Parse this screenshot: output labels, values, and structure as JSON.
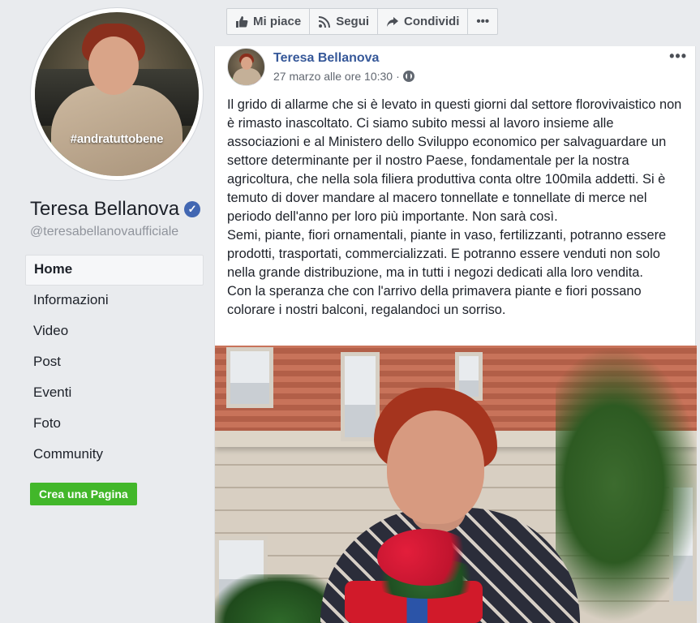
{
  "sidebar": {
    "profile_tag": "#andratuttobene",
    "page_name": "Teresa Bellanova",
    "handle": "@teresabellanovaufficiale",
    "nav_items": [
      {
        "label": "Home",
        "active": true
      },
      {
        "label": "Informazioni"
      },
      {
        "label": "Video"
      },
      {
        "label": "Post"
      },
      {
        "label": "Eventi"
      },
      {
        "label": "Foto"
      },
      {
        "label": "Community"
      }
    ],
    "create_page_label": "Crea una Pagina"
  },
  "actionbar": {
    "like_label": "Mi piace",
    "follow_label": "Segui",
    "share_label": "Condividi",
    "more_label": "•••"
  },
  "post": {
    "author": "Teresa Bellanova",
    "timestamp": "27 marzo alle ore 10:30",
    "separator": "·",
    "more_label": "•••",
    "text": "Il grido di allarme che si è levato in questi giorni dal settore florovivaistico non è rimasto inascoltato. Ci siamo subito messi al lavoro insieme alle associazioni e al Ministero dello Sviluppo economico per salvaguardare un settore determinante per il nostro Paese, fondamentale per la nostra agricoltura, che nella sola filiera produttiva conta oltre 100mila addetti. Si è temuto di dover mandare al macero tonnellate e tonnellate di merce nel periodo dell'anno per loro più importante. Non sarà così.\nSemi, piante, fiori ornamentali, piante in vaso, fertilizzanti, potranno essere prodotti, trasportati, commercializzati. E potranno essere venduti non solo nella grande distribuzione, ma in tutti i negozi dedicati alla loro vendita.\nCon la speranza che con l'arrivo della primavera piante e fiori possano colorare i nostri balconi, regalandoci un sorriso."
  },
  "colors": {
    "link": "#365899",
    "verified": "#4267b2",
    "create_button": "#42b72a",
    "background": "#e9ebee"
  },
  "icons": {
    "verified": "verified-badge-icon",
    "like": "thumbs-up-icon",
    "follow": "rss-icon",
    "share": "share-arrow-icon",
    "privacy": "globe-icon"
  }
}
